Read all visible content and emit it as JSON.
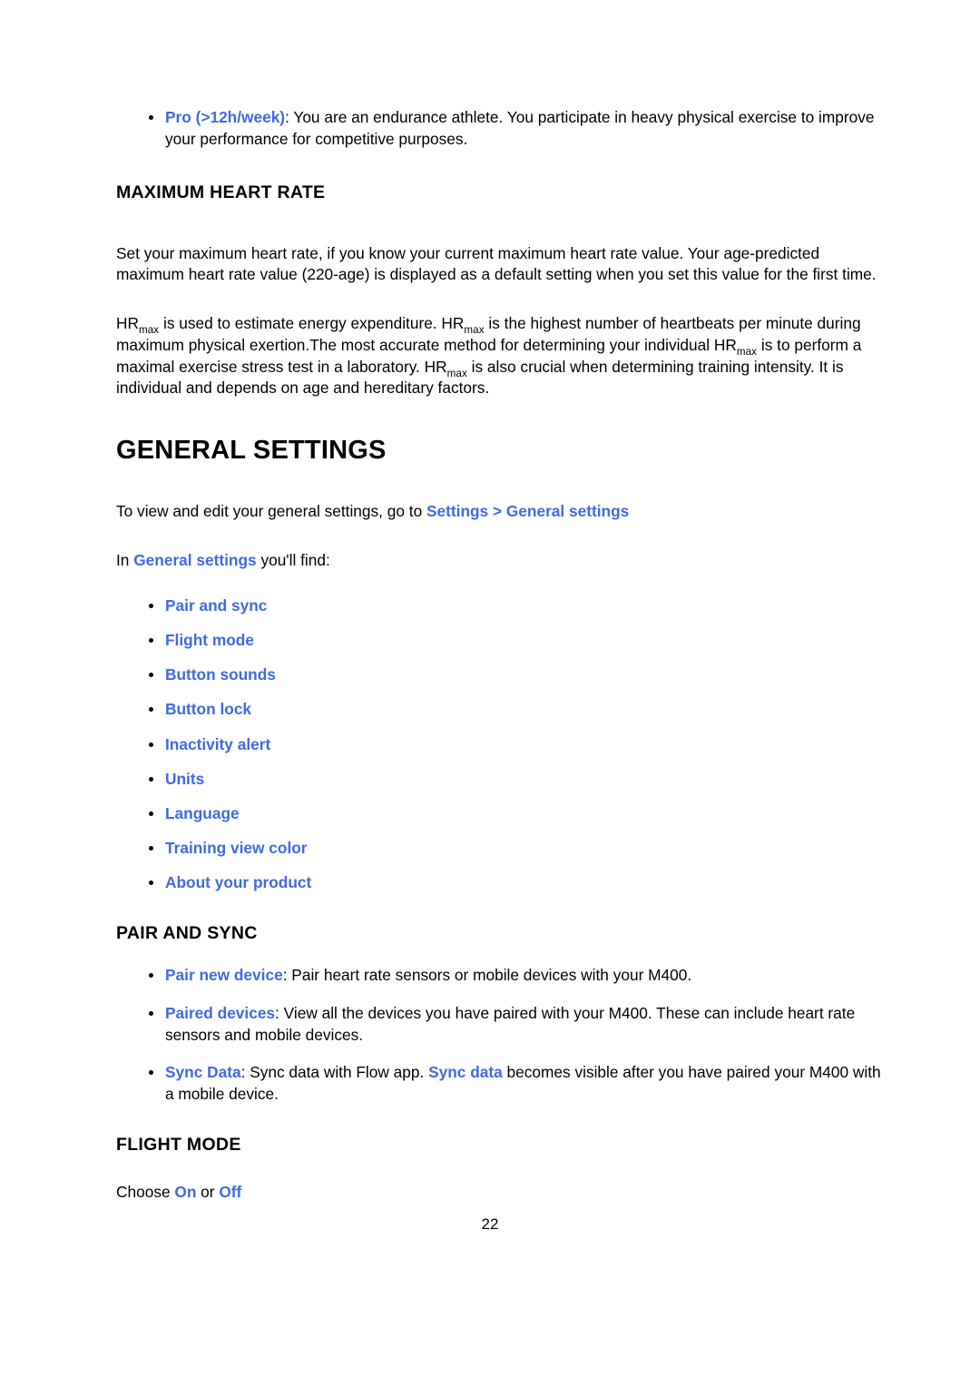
{
  "document": {
    "page_number": "22",
    "accent_color": "#4169e1",
    "text_color": "#000000",
    "background_color": "#ffffff"
  },
  "intro_bullet": {
    "term": "Pro (>12h/week)",
    "separator": ":",
    "text": " You are an endurance athlete. You participate in heavy physical exercise to improve your performance for competitive purposes."
  },
  "maximum_heart_rate": {
    "heading": "MAXIMUM HEART RATE",
    "paragraph_1": "Set your maximum heart rate, if you know your current maximum heart rate value. Your age-predicted maximum heart rate value (220-age) is displayed as a default setting when you set this value for the first time.",
    "paragraph_2": {
      "term": "HR",
      "subscript": "max",
      "seg_1": " is used to estimate energy expenditure. ",
      "seg_2": " is the highest number of heartbeats per minute during maximum physical exertion.The most accurate method for determining your individual ",
      "seg_3": " is to perform a maximal exercise stress test in a laboratory. ",
      "seg_4": " is also crucial when determining training intensity. It is individual and depends on age and hereditary factors."
    }
  },
  "general_settings": {
    "heading": "GENERAL SETTINGS",
    "intro_prefix": "To view and edit your general settings, go to ",
    "intro_link": "Settings > General settings",
    "find_prefix": "In ",
    "find_link": "General settings",
    "find_suffix": " you'll find:",
    "items": [
      {
        "label": "Pair and sync"
      },
      {
        "label": "Flight mode"
      },
      {
        "label": "Button sounds"
      },
      {
        "label": "Button lock"
      },
      {
        "label": "Inactivity alert"
      },
      {
        "label": "Units"
      },
      {
        "label": "Language"
      },
      {
        "label": "Training view color"
      },
      {
        "label": "About your product"
      }
    ]
  },
  "pair_and_sync": {
    "heading": "PAIR AND SYNC",
    "items": [
      {
        "term": "Pair new device",
        "separator": ":",
        "text": " Pair heart rate sensors or mobile devices with your M400."
      },
      {
        "term": "Paired devices",
        "separator": ":",
        "text": " View all the devices you have paired with your M400. These can include heart rate sensors and mobile devices."
      },
      {
        "term": "Sync Data",
        "separator": ":",
        "text_before": " Sync data with Flow app. ",
        "term_2": "Sync data",
        "text_after": " becomes visible after you have paired your M400 with a mobile device."
      }
    ]
  },
  "flight_mode": {
    "heading": "FLIGHT MODE",
    "choose_prefix": "Choose ",
    "option_on": "On",
    "choose_middle": " or ",
    "option_off": "Off"
  }
}
